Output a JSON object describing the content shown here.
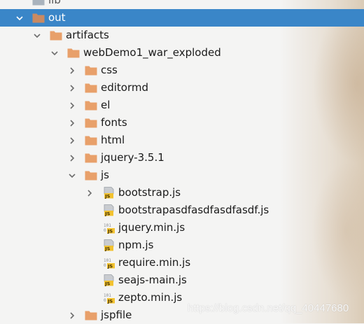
{
  "tree": {
    "rows": [
      {
        "label": "lib",
        "kind": "folder",
        "depth": 0,
        "expand": "none",
        "selected": false,
        "partial": true
      },
      {
        "label": "out",
        "kind": "folder",
        "depth": 0,
        "expand": "expanded",
        "selected": true
      },
      {
        "label": "artifacts",
        "kind": "folder",
        "depth": 1,
        "expand": "expanded"
      },
      {
        "label": "webDemo1_war_exploded",
        "kind": "folder",
        "depth": 2,
        "expand": "expanded"
      },
      {
        "label": "css",
        "kind": "folder",
        "depth": 3,
        "expand": "collapsed"
      },
      {
        "label": "editormd",
        "kind": "folder",
        "depth": 3,
        "expand": "collapsed"
      },
      {
        "label": "el",
        "kind": "folder",
        "depth": 3,
        "expand": "collapsed"
      },
      {
        "label": "fonts",
        "kind": "folder",
        "depth": 3,
        "expand": "collapsed"
      },
      {
        "label": "html",
        "kind": "folder",
        "depth": 3,
        "expand": "collapsed"
      },
      {
        "label": "jquery-3.5.1",
        "kind": "folder",
        "depth": 3,
        "expand": "collapsed"
      },
      {
        "label": "js",
        "kind": "folder",
        "depth": 3,
        "expand": "expanded"
      },
      {
        "label": "bootstrap.js",
        "kind": "js-file",
        "depth": 4,
        "expand": "collapsed"
      },
      {
        "label": "bootstrapasdfasdfasdfasdf.js",
        "kind": "js-file",
        "depth": 4,
        "expand": "none"
      },
      {
        "label": "jquery.min.js",
        "kind": "min-js-file",
        "depth": 4,
        "expand": "none"
      },
      {
        "label": "npm.js",
        "kind": "js-file",
        "depth": 4,
        "expand": "none"
      },
      {
        "label": "require.min.js",
        "kind": "min-js-file",
        "depth": 4,
        "expand": "none"
      },
      {
        "label": "seajs-main.js",
        "kind": "js-file",
        "depth": 4,
        "expand": "none"
      },
      {
        "label": "zepto.min.js",
        "kind": "min-js-file",
        "depth": 4,
        "expand": "none"
      },
      {
        "label": "jspfile",
        "kind": "folder",
        "depth": 3,
        "expand": "collapsed"
      }
    ]
  },
  "icons": {
    "folder": "folder-icon",
    "js-file": "javascript-file-icon",
    "min-js-file": "minified-javascript-file-icon",
    "chevron-expanded": "chevron-down-icon",
    "chevron-collapsed": "chevron-right-icon"
  },
  "colors": {
    "selection": "#3a86c8",
    "folder": "#e8a06a",
    "folder_excluded": "#c98a62",
    "js_badge": "#f2c230"
  },
  "watermark": "https://blog.csdn.net/qq_40447680"
}
